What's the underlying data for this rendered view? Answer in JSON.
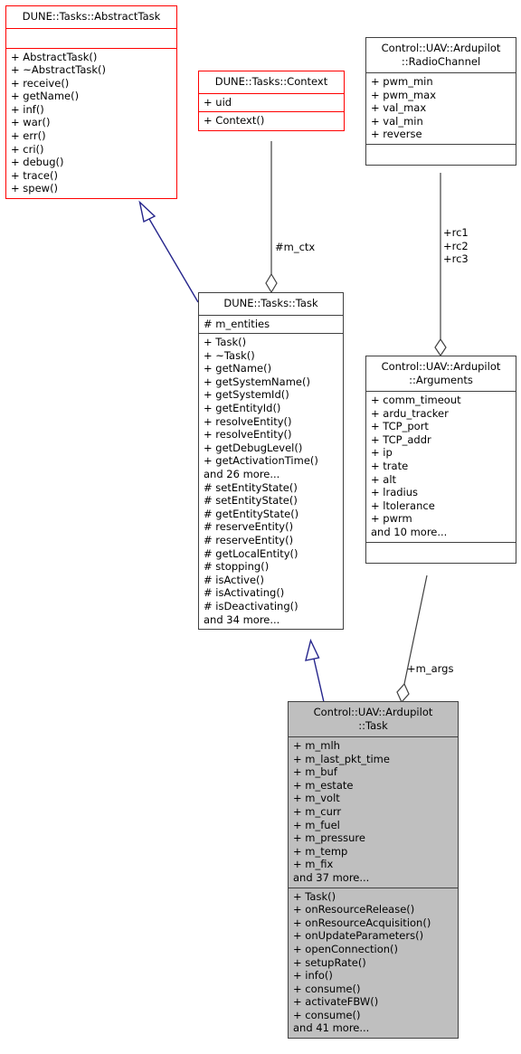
{
  "diagram": {
    "type": "uml-class-diagram",
    "title": "Control::UAV::Ardupilot::Task inheritance/collaboration diagram"
  },
  "colors": {
    "highlight_border": "#ff0000",
    "normal_border": "#404040",
    "focus_fill": "#bfbfbf",
    "inheritance_edge": "#25258c",
    "association_edge": "#404040",
    "background": "#ffffff"
  },
  "classes": {
    "abstract_task": {
      "name": "DUNE::Tasks::AbstractTask",
      "attributes": [],
      "operations": [
        "+ AbstractTask()",
        "+ ~AbstractTask()",
        "+ receive()",
        "+ getName()",
        "+ inf()",
        "+ war()",
        "+ err()",
        "+ cri()",
        "+ debug()",
        "+ trace()",
        "+ spew()"
      ]
    },
    "context": {
      "name": "DUNE::Tasks::Context",
      "attributes": [
        "+ uid"
      ],
      "operations": [
        "+ Context()"
      ]
    },
    "radio_channel": {
      "name": "Control::UAV::Ardupilot\n::RadioChannel",
      "attributes": [
        "+ pwm_min",
        "+ pwm_max",
        "+ val_max",
        "+ val_min",
        "+ reverse"
      ],
      "operations": []
    },
    "dune_task": {
      "name": "DUNE::Tasks::Task",
      "attributes": [
        "# m_entities"
      ],
      "operations": [
        "+ Task()",
        "+ ~Task()",
        "+ getName()",
        "+ getSystemName()",
        "+ getSystemId()",
        "+ getEntityId()",
        "+ resolveEntity()",
        "+ resolveEntity()",
        "+ getDebugLevel()",
        "+ getActivationTime()",
        "and 26 more...",
        "# setEntityState()",
        "# setEntityState()",
        "# getEntityState()",
        "# reserveEntity()",
        "# reserveEntity()",
        "# getLocalEntity()",
        "# stopping()",
        "# isActive()",
        "# isActivating()",
        "# isDeactivating()",
        "and 34 more..."
      ]
    },
    "arguments": {
      "name": "Control::UAV::Ardupilot\n::Arguments",
      "attributes": [
        "+ comm_timeout",
        "+ ardu_tracker",
        "+ TCP_port",
        "+ TCP_addr",
        "+ ip",
        "+ trate",
        "+ alt",
        "+ lradius",
        "+ ltolerance",
        "+ pwrm",
        "and 10 more..."
      ],
      "operations": []
    },
    "ardupilot_task": {
      "name": "Control::UAV::Ardupilot\n::Task",
      "attributes": [
        "+ m_mlh",
        "+ m_last_pkt_time",
        "+ m_buf",
        "+ m_estate",
        "+ m_volt",
        "+ m_curr",
        "+ m_fuel",
        "+ m_pressure",
        "+ m_temp",
        "+ m_fix",
        "and 37 more..."
      ],
      "operations": [
        "+ Task()",
        "+ onResourceRelease()",
        "+ onResourceAcquisition()",
        "+ onUpdateParameters()",
        "+ openConnection()",
        "+ setupRate()",
        "+ info()",
        "+ consume()",
        "+ activateFBW()",
        "+ consume()",
        "and 41 more..."
      ]
    }
  },
  "edges": {
    "ctx_label": "#m_ctx",
    "rc_label": "+rc1\n+rc2\n+rc3",
    "args_label": "+m_args"
  }
}
